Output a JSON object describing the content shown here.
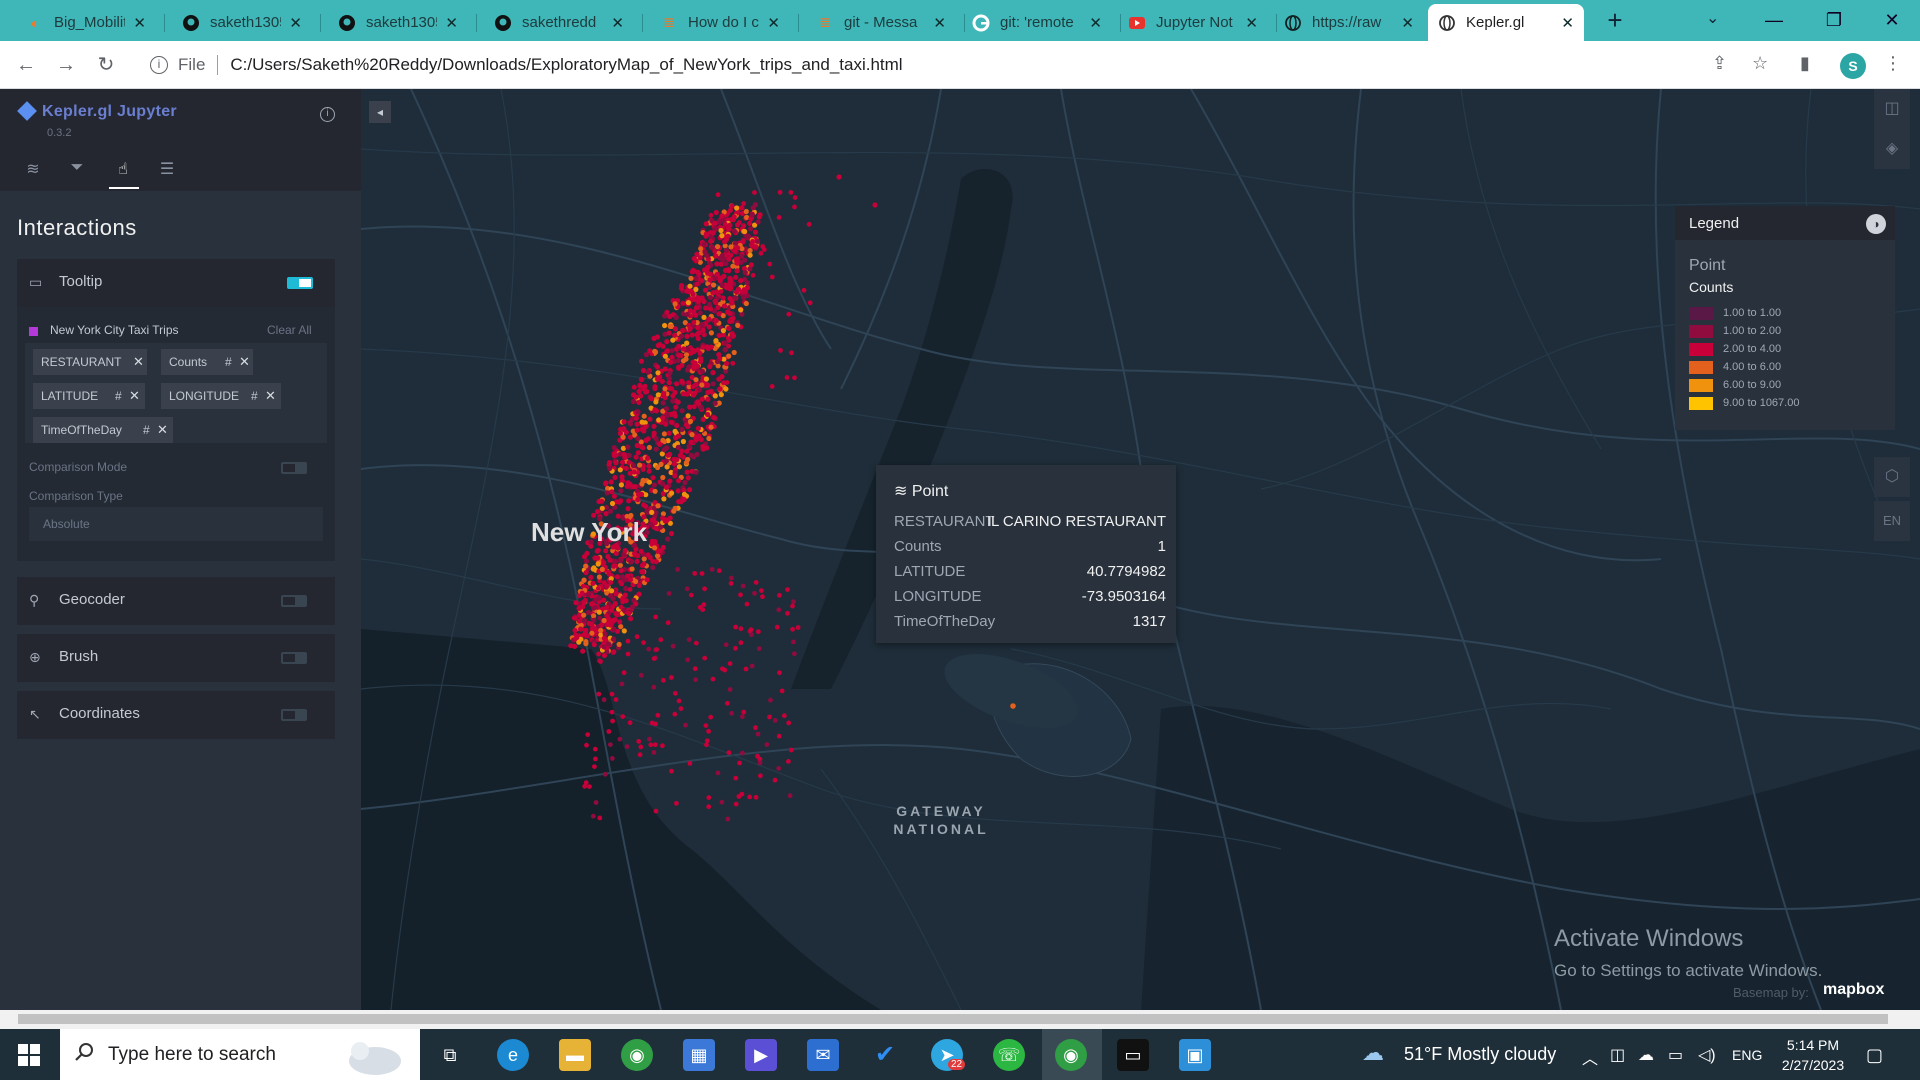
{
  "browser": {
    "tabs": [
      {
        "label": "Big_Mobilit",
        "icon": "jupyter-icon"
      },
      {
        "label": "saketh1305",
        "icon": "github-icon"
      },
      {
        "label": "saketh1305",
        "icon": "github-icon"
      },
      {
        "label": "sakethredd",
        "icon": "github-icon"
      },
      {
        "label": "How do I cl",
        "icon": "stackoverflow-icon"
      },
      {
        "label": "git - Messa",
        "icon": "stackoverflow-icon"
      },
      {
        "label": "git: 'remote",
        "icon": "google-icon"
      },
      {
        "label": "Jupyter Not",
        "icon": "youtube-icon"
      },
      {
        "label": "https://raw",
        "icon": "globe-icon"
      },
      {
        "label": "Kepler.gl",
        "icon": "globe-icon",
        "active": true
      }
    ],
    "address": {
      "scheme_label": "File",
      "url": "C:/Users/Saketh%20Reddy/Downloads/ExploratoryMap_of_NewYork_trips_and_taxi.html"
    },
    "profile_initial": "S"
  },
  "sidebar": {
    "brand": "Kepler.gl Jupyter",
    "version": "0.3.2",
    "panel_title": "Interactions",
    "tooltip_section": {
      "label": "Tooltip",
      "enabled": true,
      "layer_name": "New York City Taxi Trips",
      "clear_all": "Clear All",
      "fields": [
        {
          "name": "RESTAURANT",
          "numeric": false
        },
        {
          "name": "Counts",
          "numeric": true
        },
        {
          "name": "LATITUDE",
          "numeric": true
        },
        {
          "name": "LONGITUDE",
          "numeric": true
        },
        {
          "name": "TimeOfTheDay",
          "numeric": true
        }
      ],
      "comparison_mode_label": "Comparison Mode",
      "comparison_type_label": "Comparison Type",
      "comparison_type_value": "Absolute"
    },
    "sections": [
      {
        "label": "Geocoder",
        "enabled": false
      },
      {
        "label": "Brush",
        "enabled": false
      },
      {
        "label": "Coordinates",
        "enabled": false
      }
    ]
  },
  "legend": {
    "title": "Legend",
    "layer_type": "Point",
    "field": "Counts",
    "items": [
      {
        "label": "1.00 to 1.00",
        "color": "#5a1846"
      },
      {
        "label": "1.00 to 2.00",
        "color": "#900c3f"
      },
      {
        "label": "2.00 to 4.00",
        "color": "#c70039"
      },
      {
        "label": "4.00 to 6.00",
        "color": "#e3611c"
      },
      {
        "label": "6.00 to 9.00",
        "color": "#f1920e"
      },
      {
        "label": "9.00 to 1067.00",
        "color": "#ffc300"
      }
    ]
  },
  "map_tooltip": {
    "title": "Point",
    "rows": [
      {
        "key": "RESTAURANT",
        "value": "IL CARINO RESTAURANT"
      },
      {
        "key": "Counts",
        "value": "1"
      },
      {
        "key": "LATITUDE",
        "value": "40.7794982"
      },
      {
        "key": "LONGITUDE",
        "value": "-73.9503164"
      },
      {
        "key": "TimeOfTheDay",
        "value": "1317"
      }
    ]
  },
  "map_labels": {
    "city": "New York",
    "gateway_line1": "GATEWAY",
    "gateway_line2": "NATIONAL",
    "lang_button": "EN",
    "basemap": "Basemap by:",
    "mapbox": "mapbox"
  },
  "windows_watermark": {
    "line1": "Activate Windows",
    "line2": "Go to Settings to activate Windows."
  },
  "taskbar": {
    "search_placeholder": "Type here to search",
    "weather": "51°F  Mostly cloudy",
    "language": "ENG",
    "time": "5:14 PM",
    "date": "2/27/2023",
    "telegram_badge": "22"
  }
}
